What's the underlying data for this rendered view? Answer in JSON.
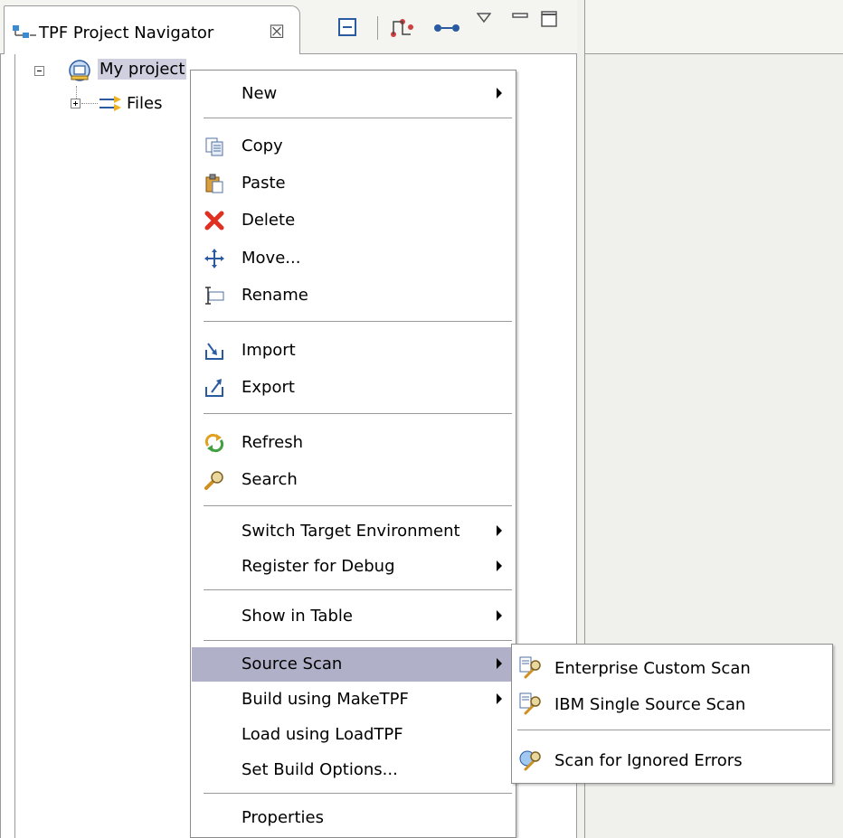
{
  "view": {
    "tab_title": "TPF Project Navigator",
    "close_glyph": "☒",
    "toolbar": [
      "collapse-all-icon",
      "filter-icon",
      "link-with-editor-icon",
      "view-menu-icon",
      "minimize-icon",
      "maximize-icon"
    ]
  },
  "tree": {
    "project_label": "My project",
    "files_label": "Files"
  },
  "menu": {
    "new": "New",
    "copy": "Copy",
    "paste": "Paste",
    "delete": "Delete",
    "move": "Move...",
    "rename": "Rename",
    "import": "Import",
    "export": "Export",
    "refresh": "Refresh",
    "search": "Search",
    "switch_env": "Switch Target Environment",
    "register_debug": "Register for Debug",
    "show_table": "Show in Table",
    "source_scan": "Source Scan",
    "build": "Build using MakeTPF",
    "load": "Load using LoadTPF",
    "set_build": "Set Build Options...",
    "properties": "Properties"
  },
  "submenu": {
    "enterprise": "Enterprise Custom Scan",
    "ibm": "IBM Single Source Scan",
    "ignored": "Scan for Ignored Errors"
  },
  "colors": {
    "highlight": "#b0b0c8",
    "selection": "#cfcfe0",
    "delete_red": "#e03020"
  }
}
